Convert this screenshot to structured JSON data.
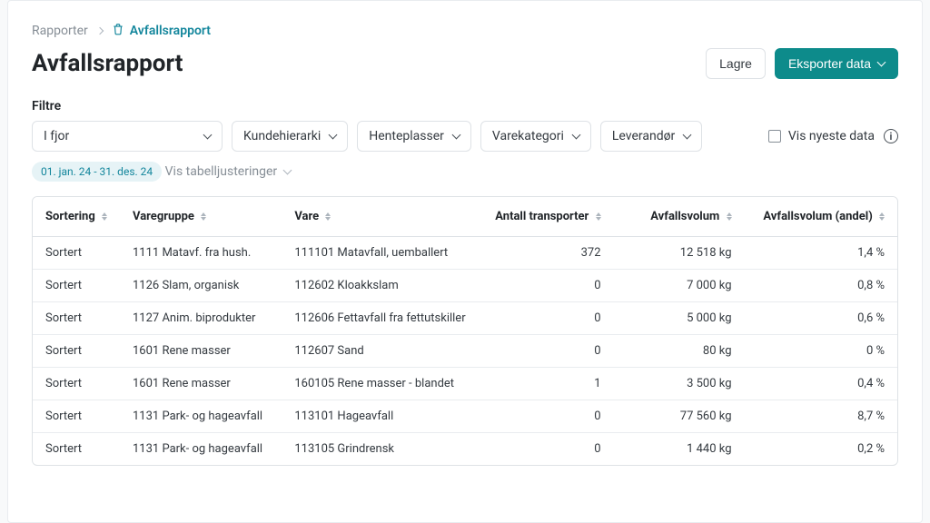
{
  "breadcrumb": {
    "root": "Rapporter",
    "current": "Avfallsrapport"
  },
  "page_title": "Avfallsrapport",
  "actions": {
    "save": "Lagre",
    "export": "Eksporter data"
  },
  "filters": {
    "label": "Filtre",
    "period": "I fjor",
    "customer_hierarchy": "Kundehierarki",
    "pickup_locations": "Henteplasser",
    "product_category": "Varekategori",
    "supplier": "Leverandør",
    "show_latest_data": "Vis nyeste data",
    "date_range_badge": "01. jan. 24 - 31. des. 24",
    "table_adjustments": "Vis tabelljusteringer"
  },
  "columns": {
    "sortering": "Sortering",
    "varegruppe": "Varegruppe",
    "vare": "Vare",
    "antall_transporter": "Antall transporter",
    "avfallsvolum": "Avfallsvolum",
    "avfallsvolum_andel": "Avfallsvolum (andel)"
  },
  "rows": [
    {
      "sortering": "Sortert",
      "varegruppe": "1111 Matavf. fra hush.",
      "vare": "111101 Matavfall, uemballert",
      "transporter": "372",
      "volum": "12 518 kg",
      "andel": "1,4 %"
    },
    {
      "sortering": "Sortert",
      "varegruppe": "1126 Slam, organisk",
      "vare": "112602 Kloakkslam",
      "transporter": "0",
      "volum": "7 000 kg",
      "andel": "0,8 %"
    },
    {
      "sortering": "Sortert",
      "varegruppe": "1127 Anim. biprodukter",
      "vare": "112606 Fettavfall fra fettutskiller",
      "transporter": "0",
      "volum": "5 000 kg",
      "andel": "0,6 %"
    },
    {
      "sortering": "Sortert",
      "varegruppe": "1601 Rene masser",
      "vare": "112607 Sand",
      "transporter": "0",
      "volum": "80 kg",
      "andel": "0 %"
    },
    {
      "sortering": "Sortert",
      "varegruppe": "1601 Rene masser",
      "vare": "160105 Rene masser - blandet",
      "transporter": "1",
      "volum": "3 500 kg",
      "andel": "0,4 %"
    },
    {
      "sortering": "Sortert",
      "varegruppe": "1131 Park- og hageavfall",
      "vare": "113101 Hageavfall",
      "transporter": "0",
      "volum": "77 560 kg",
      "andel": "8,7 %"
    },
    {
      "sortering": "Sortert",
      "varegruppe": "1131 Park- og hageavfall",
      "vare": "113105 Grindrensk",
      "transporter": "0",
      "volum": "1 440 kg",
      "andel": "0,2 %"
    }
  ]
}
